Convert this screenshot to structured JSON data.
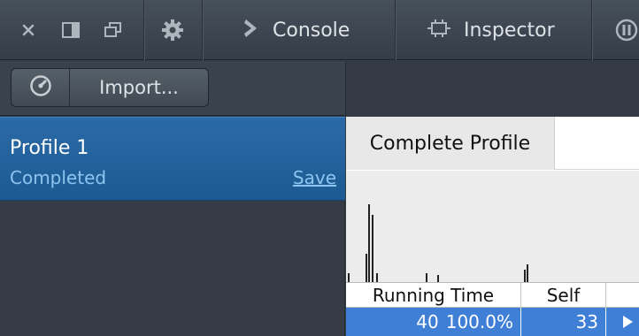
{
  "toolbar": {
    "icons": [
      "close-icon",
      "dock-side-icon",
      "undock-window-icon",
      "settings-gear-icon",
      "pause-icon"
    ],
    "tabs": [
      {
        "label": "Console",
        "icon": "chevron-right-icon"
      },
      {
        "label": "Inspector",
        "icon": "inspector-icon"
      }
    ]
  },
  "subtoolbar": {
    "icon": "profiler-gauge-icon",
    "import_label": "Import..."
  },
  "sidebar": {
    "profile": {
      "name": "Profile 1",
      "status": "Completed",
      "save_label": "Save"
    }
  },
  "main": {
    "view_tab": "Complete Profile",
    "columns": [
      "Running Time",
      "Self"
    ],
    "row": {
      "running_time": "40",
      "running_pct": "100.0%",
      "self": "33"
    }
  },
  "colors": {
    "selection": "#1f5d97",
    "row_highlight": "#3f7fd6"
  }
}
